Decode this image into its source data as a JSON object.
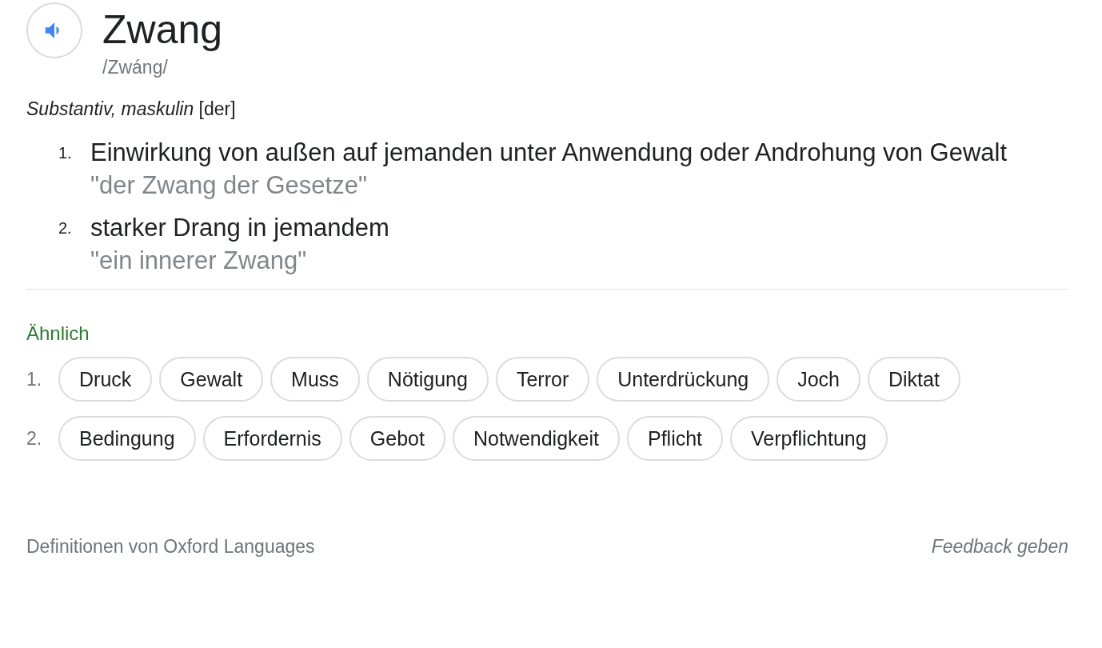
{
  "entry": {
    "headword": "Zwang",
    "pronunciation": "/Zwáng/",
    "grammar": "*Substantiv, maskulin* [der]"
  },
  "definitions": [
    {
      "number": "1.",
      "text": "Einwirkung von außen auf jemanden unter Anwendung oder Androhung von Gewalt",
      "example": "\"der Zwang der Gesetze\""
    },
    {
      "number": "2.",
      "text": "starker Drang in jemandem",
      "example": "\"ein innerer Zwang\""
    }
  ],
  "similar": {
    "heading": "Ähnlich",
    "groups": [
      {
        "number": "1.",
        "words": [
          "Druck",
          "Gewalt",
          "Muss",
          "Nötigung",
          "Terror",
          "Unterdrückung",
          "Joch",
          "Diktat"
        ]
      },
      {
        "number": "2.",
        "words": [
          "Bedingung",
          "Erfordernis",
          "Gebot",
          "Notwendigkeit",
          "Pflicht",
          "Verpflichtung"
        ]
      }
    ]
  },
  "footer": {
    "source": "Definitionen von Oxford Languages",
    "feedback": "Feedback geben"
  }
}
